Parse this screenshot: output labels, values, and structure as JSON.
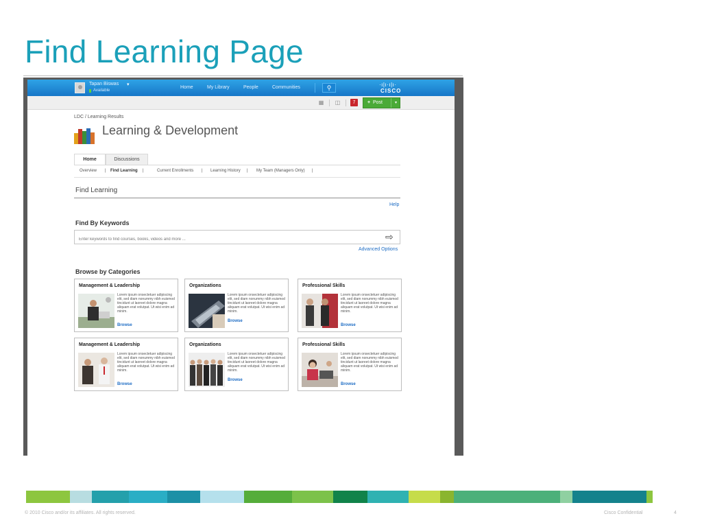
{
  "slide": {
    "title": "Find Learning Page",
    "footer_copyright": "© 2010 Cisco and/or its affiliates. All rights reserved.",
    "footer_confidential": "Cisco Confidential",
    "page_number": "4",
    "stripe_colors": [
      "#8dc63f",
      "#b8dde1",
      "#24a0ab",
      "#2aaec5",
      "#1c90a6",
      "#b5e0ec",
      "#55ad3a",
      "#7cc24a",
      "#11834a",
      "#2fb2b2",
      "#c6dc4a",
      "#8ab52f",
      "#4cb07a",
      "#8fd0a1",
      "#14828c"
    ]
  },
  "topbar": {
    "user_name": "Tapan Biswas",
    "user_status": "Available",
    "caret": "▾",
    "nav": [
      "Home",
      "My Library",
      "People",
      "Communities"
    ],
    "search_icon": "⚲",
    "brand_bars": "·ı|ı·ı|ı·",
    "brand": "CISCO"
  },
  "toolbar": {
    "badge_count": "7",
    "post_plus": "+",
    "post_label": "Post",
    "post_caret": "▾"
  },
  "page": {
    "breadcrumb": "LDC / Learning Results",
    "app_title": "Learning & Development",
    "tabs": [
      "Home",
      "Discussions"
    ],
    "subnav": [
      "Overview",
      "|",
      "Find Learning",
      "|",
      "Current Enrollments",
      "|",
      "Learning History",
      "|",
      "My Team (Managers Only)",
      "|"
    ],
    "section_title": "Find Learning",
    "help": "Help",
    "keywords_title": "Find By Keywords",
    "keywords_placeholder": "Enter keywords to find courses, books, videos and more ...",
    "search_arrow": "⇨",
    "advanced": "Advanced Options",
    "browse_title": "Browse by Categories",
    "browse_link": "Browse",
    "cards": [
      {
        "title": "Management & Leadership",
        "desc": "Lorem ipsum onsectetuer adipiscing elit, sed diam nonummy nibh euismod tincidunt ut laoreet dolore magna aliquam erat volutpat. Ut wisi enim ad minim."
      },
      {
        "title": "Organizations",
        "desc": "Lorem ipsum onsectetuer adipiscing elit, sed diam nonummy nibh euismod tincidunt ut laoreet dolore magna aliquam erat volutpat. Ut wisi enim ad minim."
      },
      {
        "title": "Professional Skills",
        "desc": "Lorem ipsum onsectetuer adipiscing elit, sed diam nonummy nibh euismod tincidunt ut laoreet dolore magna aliquam erat volutpat. Ut wisi enim ad minim."
      },
      {
        "title": "Management & Leadership",
        "desc": "Lorem ipsum onsectetuer adipiscing elit, sed diam nonummy nibh euismod tincidunt ut laoreet dolore magna aliquam erat volutpat. Ut wisi enim ad minim."
      },
      {
        "title": "Organizations",
        "desc": "Lorem ipsum onsectetuer adipiscing elit, sed diam nonummy nibh euismod tincidunt ut laoreet dolore magna aliquam erat volutpat. Ut wisi enim ad minim."
      },
      {
        "title": "Professional Skills",
        "desc": "Lorem ipsum onsectetuer adipiscing elit, sed diam nonummy nibh euismod tincidunt ut laoreet dolore magna aliquam erat volutpat. Ut wisi enim ad minim."
      }
    ]
  }
}
